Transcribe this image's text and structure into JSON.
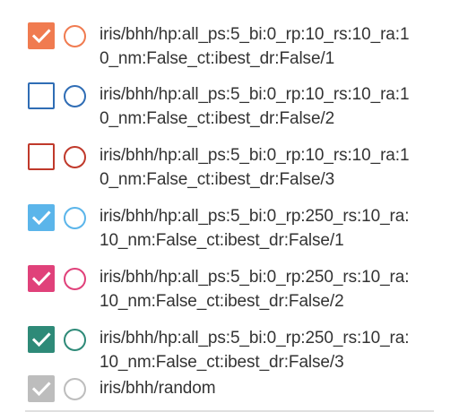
{
  "runs": [
    {
      "line1": "iris/bhh/hp:all_ps:5_bi:0_rp:10_rs:10_ra:1",
      "line2": "0_nm:False_ct:ibest_dr:False/1",
      "checked": true,
      "color": "#f07b50"
    },
    {
      "line1": "iris/bhh/hp:all_ps:5_bi:0_rp:10_rs:10_ra:1",
      "line2": "0_nm:False_ct:ibest_dr:False/2",
      "checked": false,
      "color": "#2f6db5"
    },
    {
      "line1": "iris/bhh/hp:all_ps:5_bi:0_rp:10_rs:10_ra:1",
      "line2": "0_nm:False_ct:ibest_dr:False/3",
      "checked": false,
      "color": "#c0392b"
    },
    {
      "line1": "iris/bhh/hp:all_ps:5_bi:0_rp:250_rs:10_ra:",
      "line2": "10_nm:False_ct:ibest_dr:False/1",
      "checked": true,
      "color": "#5bb5ea"
    },
    {
      "line1": "iris/bhh/hp:all_ps:5_bi:0_rp:250_rs:10_ra:",
      "line2": "10_nm:False_ct:ibest_dr:False/2",
      "checked": true,
      "color": "#e0417a"
    },
    {
      "line1": "iris/bhh/hp:all_ps:5_bi:0_rp:250_rs:10_ra:",
      "line2": "10_nm:False_ct:ibest_dr:False/3",
      "checked": true,
      "color": "#2e8a78"
    },
    {
      "line1": "iris/bhh/random",
      "line2": "",
      "checked": true,
      "color": "#bdbdbd"
    }
  ],
  "icons": {
    "checkbox": "checkmark-icon",
    "color_picker": "color-circle-icon"
  }
}
